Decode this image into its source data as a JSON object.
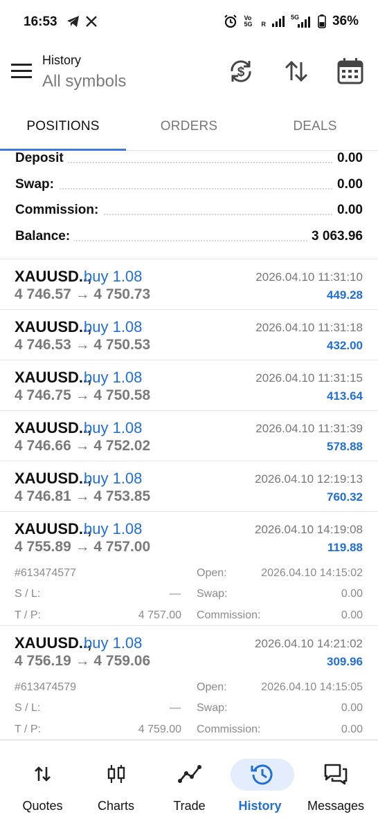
{
  "status_bar": {
    "time": "16:53",
    "left_icons": [
      "telegram-icon",
      "x-icon"
    ],
    "right_icons": [
      "alarm-icon",
      "volte-icon",
      "signal-icon",
      "signal-5g-icon",
      "battery-icon"
    ],
    "volte_text": "Vo 5G",
    "roaming_text": "R",
    "network_text": "5G",
    "battery": "36%"
  },
  "header": {
    "title": "History",
    "subtitle": "All symbols",
    "icons": [
      "currency-refresh-icon",
      "sort-icon",
      "calendar-icon"
    ]
  },
  "tabs": [
    {
      "label": "POSITIONS",
      "active": true
    },
    {
      "label": "ORDERS",
      "active": false
    },
    {
      "label": "DEALS",
      "active": false
    }
  ],
  "summary": [
    {
      "label": "Deposit",
      "value": "0.00"
    },
    {
      "label": "Swap:",
      "value": "0.00"
    },
    {
      "label": "Commission:",
      "value": "0.00"
    },
    {
      "label": "Balance:",
      "value": "3 063.96"
    }
  ],
  "positions": [
    {
      "symbol": "XAUUSD..,",
      "side": "buy 1.08",
      "prices": "4 746.57 → 4 750.73",
      "time": "2026.04.10 11:31:10",
      "profit": "449.28"
    },
    {
      "symbol": "XAUUSD..,",
      "side": "buy 1.08",
      "prices": "4 746.53 → 4 750.53",
      "time": "2026.04.10 11:31:18",
      "profit": "432.00"
    },
    {
      "symbol": "XAUUSD..,",
      "side": "buy 1.08",
      "prices": "4 746.75 → 4 750.58",
      "time": "2026.04.10 11:31:15",
      "profit": "413.64"
    },
    {
      "symbol": "XAUUSD..,",
      "side": "buy 1.08",
      "prices": "4 746.66 → 4 752.02",
      "time": "2026.04.10 11:31:39",
      "profit": "578.88"
    },
    {
      "symbol": "XAUUSD..,",
      "side": "buy 1.08",
      "prices": "4 746.81 → 4 753.85",
      "time": "2026.04.10 12:19:13",
      "profit": "760.32"
    },
    {
      "symbol": "XAUUSD..,",
      "side": "buy 1.08",
      "prices": "4 755.89 → 4 757.00",
      "time": "2026.04.10 14:19:08",
      "profit": "119.88",
      "details": {
        "ticket": "#613474577",
        "sl_label": "S / L:",
        "sl": "—",
        "tp_label": "T / P:",
        "tp": "4 757.00",
        "open_label": "Open:",
        "open": "2026.04.10 14:15:02",
        "swap_label": "Swap:",
        "swap": "0.00",
        "commission_label": "Commission:",
        "commission": "0.00"
      }
    },
    {
      "symbol": "XAUUSD..,",
      "side": "buy 1.08",
      "prices": "4 756.19 → 4 759.06",
      "time": "2026.04.10 14:21:02",
      "profit": "309.96",
      "details": {
        "ticket": "#613474579",
        "sl_label": "S / L:",
        "sl": "—",
        "tp_label": "T / P:",
        "tp": "4 759.00",
        "open_label": "Open:",
        "open": "2026.04.10 14:15:05",
        "swap_label": "Swap:",
        "swap": "0.00",
        "commission_label": "Commission:",
        "commission": "0.00"
      }
    }
  ],
  "bottom_nav": [
    {
      "label": "Quotes",
      "icon": "quotes-arrows-icon",
      "active": false
    },
    {
      "label": "Charts",
      "icon": "candlestick-icon",
      "active": false
    },
    {
      "label": "Trade",
      "icon": "trade-line-icon",
      "active": false
    },
    {
      "label": "History",
      "icon": "history-clock-icon",
      "active": true
    },
    {
      "label": "Messages",
      "icon": "messages-icon",
      "active": false
    }
  ],
  "colors": {
    "accent": "#1f6fd6",
    "tab_indicator": "#3a7be0",
    "muted": "#7a7a7a",
    "active_pill": "#e4edfb"
  }
}
